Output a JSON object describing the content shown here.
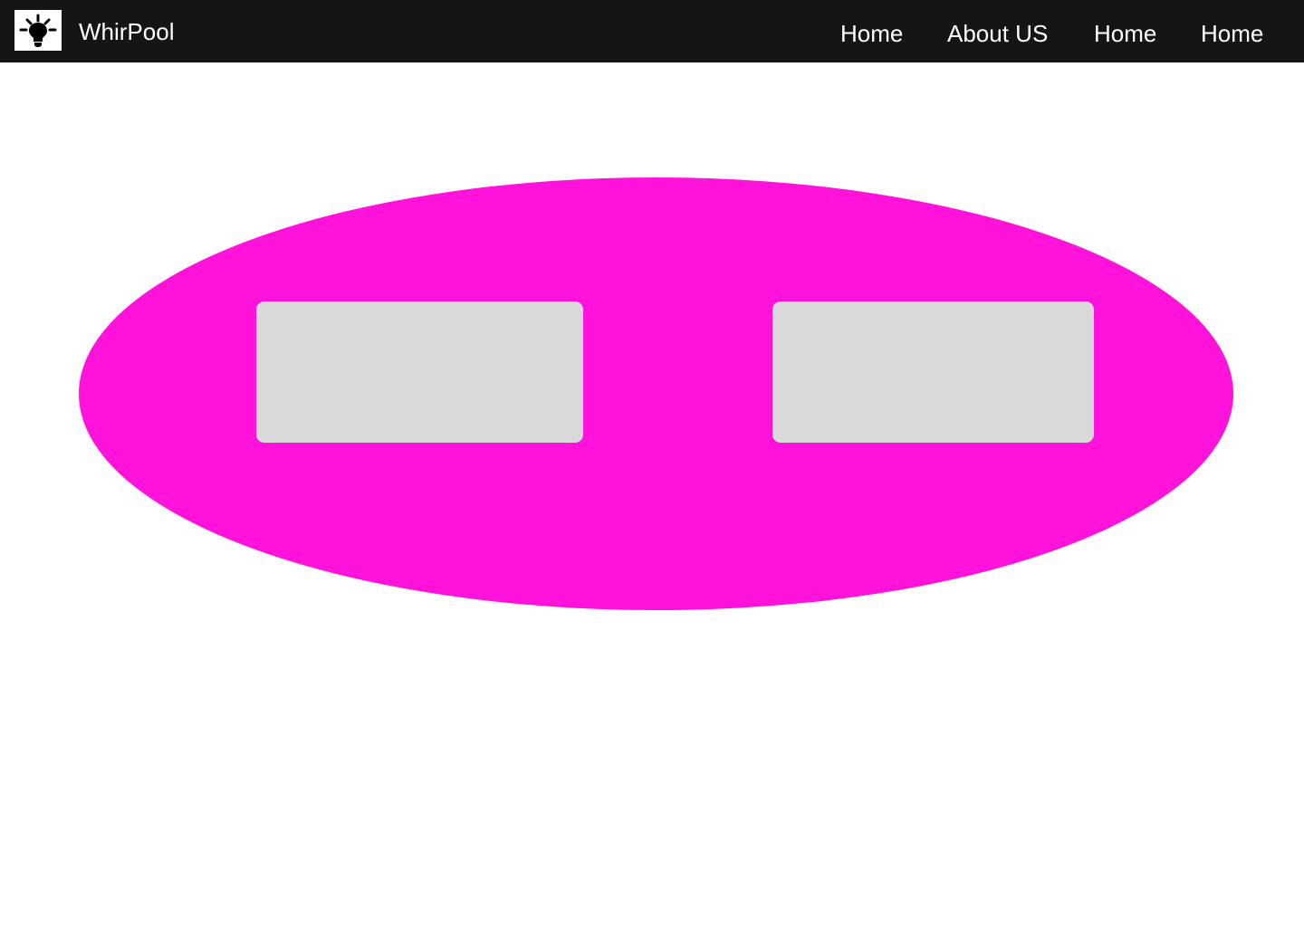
{
  "header": {
    "brand": "WhirPool",
    "logo_icon": "lightbulb-icon",
    "background": "#161516",
    "nav": [
      {
        "label": "Home"
      },
      {
        "label": "About US"
      },
      {
        "label": "Home"
      },
      {
        "label": "Home"
      }
    ]
  },
  "hero": {
    "ellipse_color": "#ff12d9",
    "card_color": "#d9d9d9",
    "cards": [
      {},
      {}
    ]
  }
}
